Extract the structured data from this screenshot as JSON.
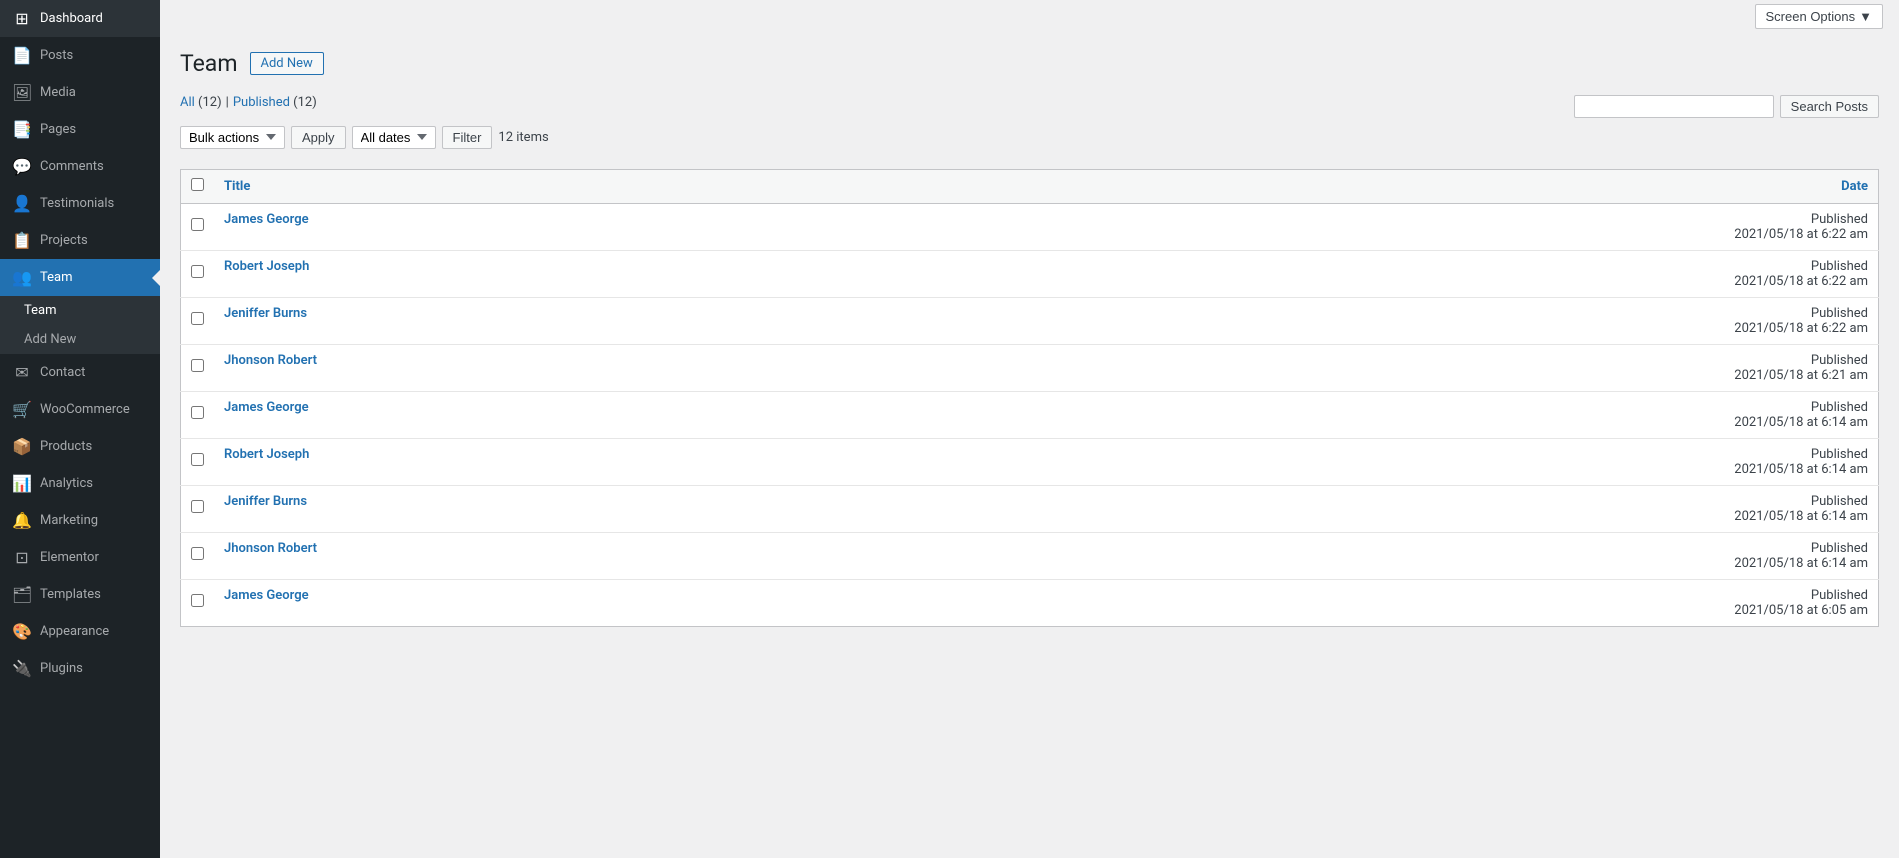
{
  "sidebar": {
    "items": [
      {
        "id": "dashboard",
        "label": "Dashboard",
        "icon": "⊞",
        "active": false
      },
      {
        "id": "posts",
        "label": "Posts",
        "icon": "📄",
        "active": false
      },
      {
        "id": "media",
        "label": "Media",
        "icon": "🖼",
        "active": false
      },
      {
        "id": "pages",
        "label": "Pages",
        "icon": "📑",
        "active": false
      },
      {
        "id": "comments",
        "label": "Comments",
        "icon": "💬",
        "active": false
      },
      {
        "id": "testimonials",
        "label": "Testimonials",
        "icon": "👤",
        "active": false
      },
      {
        "id": "projects",
        "label": "Projects",
        "icon": "📋",
        "active": false
      },
      {
        "id": "team",
        "label": "Team",
        "icon": "👥",
        "active": true
      },
      {
        "id": "contact",
        "label": "Contact",
        "icon": "✉",
        "active": false
      },
      {
        "id": "woocommerce",
        "label": "WooCommerce",
        "icon": "🛒",
        "active": false
      },
      {
        "id": "products",
        "label": "Products",
        "icon": "📦",
        "active": false
      },
      {
        "id": "analytics",
        "label": "Analytics",
        "icon": "📊",
        "active": false
      },
      {
        "id": "marketing",
        "label": "Marketing",
        "icon": "🔔",
        "active": false
      },
      {
        "id": "elementor",
        "label": "Elementor",
        "icon": "⊡",
        "active": false
      },
      {
        "id": "templates",
        "label": "Templates",
        "icon": "🗂",
        "active": false
      },
      {
        "id": "appearance",
        "label": "Appearance",
        "icon": "🎨",
        "active": false
      },
      {
        "id": "plugins",
        "label": "Plugins",
        "icon": "🔌",
        "active": false
      }
    ],
    "submenu": {
      "team_all": "Team",
      "team_add": "Add New"
    }
  },
  "topbar": {
    "screen_options_label": "Screen Options",
    "screen_options_arrow": "▼"
  },
  "page": {
    "title": "Team",
    "add_new_label": "Add New",
    "filter": {
      "all_label": "All",
      "all_count": "12",
      "published_label": "Published",
      "published_count": "12",
      "bulk_actions_label": "Bulk actions",
      "apply_label": "Apply",
      "all_dates_label": "All dates",
      "filter_label": "Filter",
      "items_count": "12 items",
      "search_placeholder": "",
      "search_btn_label": "Search Posts"
    },
    "table": {
      "col_title": "Title",
      "col_date": "Date",
      "rows": [
        {
          "id": 1,
          "title": "James George",
          "status": "Published",
          "date": "2021/05/18 at 6:22 am"
        },
        {
          "id": 2,
          "title": "Robert Joseph",
          "status": "Published",
          "date": "2021/05/18 at 6:22 am"
        },
        {
          "id": 3,
          "title": "Jeniffer Burns",
          "status": "Published",
          "date": "2021/05/18 at 6:22 am"
        },
        {
          "id": 4,
          "title": "Jhonson Robert",
          "status": "Published",
          "date": "2021/05/18 at 6:21 am"
        },
        {
          "id": 5,
          "title": "James George",
          "status": "Published",
          "date": "2021/05/18 at 6:14 am"
        },
        {
          "id": 6,
          "title": "Robert Joseph",
          "status": "Published",
          "date": "2021/05/18 at 6:14 am"
        },
        {
          "id": 7,
          "title": "Jeniffer Burns",
          "status": "Published",
          "date": "2021/05/18 at 6:14 am"
        },
        {
          "id": 8,
          "title": "Jhonson Robert",
          "status": "Published",
          "date": "2021/05/18 at 6:14 am"
        },
        {
          "id": 9,
          "title": "James George",
          "status": "Published",
          "date": "2021/05/18 at 6:05 am"
        }
      ]
    }
  }
}
